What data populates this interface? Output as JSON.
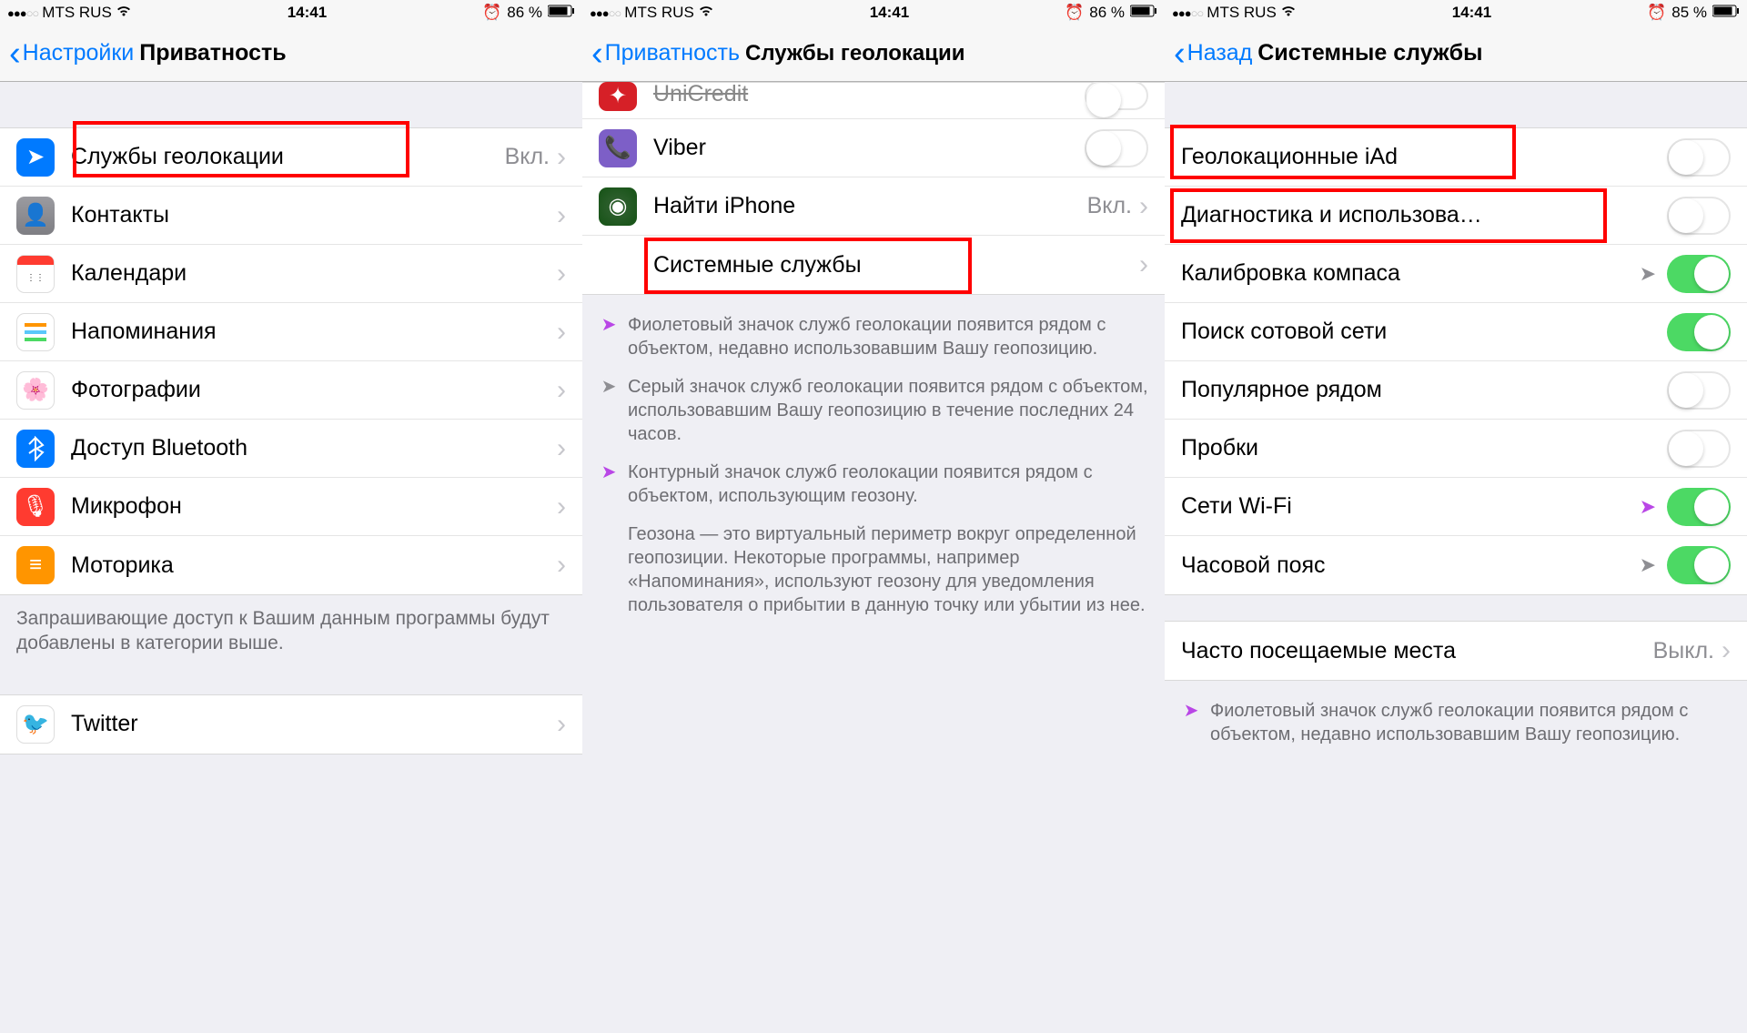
{
  "statusbar": {
    "carrier": "MTS RUS",
    "time": "14:41",
    "battery1": "86 %",
    "battery3": "85 %",
    "dots_left": "●●●",
    "dots_right": "○○"
  },
  "screen1": {
    "back": "Настройки",
    "title": "Приватность",
    "rows": {
      "location": {
        "label": "Службы геолокации",
        "value": "Вкл."
      },
      "contacts": {
        "label": "Контакты"
      },
      "calendars": {
        "label": "Календари"
      },
      "reminders": {
        "label": "Напоминания"
      },
      "photos": {
        "label": "Фотографии"
      },
      "bluetooth": {
        "label": "Доступ Bluetooth"
      },
      "microphone": {
        "label": "Микрофон"
      },
      "motion": {
        "label": "Моторика"
      }
    },
    "footer": "Запрашивающие доступ к Вашим данным программы будут добавлены в категории выше.",
    "twitter": {
      "label": "Twitter"
    }
  },
  "screen2": {
    "back": "Приватность",
    "title": "Службы геолокации",
    "rows": {
      "unicredit": {
        "label": "UniCredit"
      },
      "viber": {
        "label": "Viber"
      },
      "findmy": {
        "label": "Найти iPhone",
        "value": "Вкл."
      },
      "system": {
        "label": "Системные службы"
      }
    },
    "info": {
      "purple": "Фиолетовый значок служб геолокации появится рядом с объектом, недавно использовавшим Вашу геопозицию.",
      "gray": "Серый значок служб геолокации появится рядом с объектом, использовавшим Вашу геопозицию в течение последних 24 часов.",
      "outline": "Контурный значок служб геолокации появится рядом с объектом, использующим геозону.",
      "geofence": "Геозона — это виртуальный периметр вокруг определенной геопозиции. Некоторые программы, например «Напоминания», используют геозону для уведомления пользователя о прибытии в данную точку или убытии из нее."
    }
  },
  "screen3": {
    "back": "Назад",
    "title": "Системные службы",
    "rows": {
      "iad": {
        "label": "Геолокационные iAd"
      },
      "diag": {
        "label": "Диагностика и использова…"
      },
      "compass": {
        "label": "Калибровка компаса"
      },
      "cell": {
        "label": "Поиск сотовой сети"
      },
      "popular": {
        "label": "Популярное рядом"
      },
      "traffic": {
        "label": "Пробки"
      },
      "wifi": {
        "label": "Сети Wi-Fi"
      },
      "timezone": {
        "label": "Часовой пояс"
      },
      "frequent": {
        "label": "Часто посещаемые места",
        "value": "Выкл."
      }
    },
    "info": {
      "purple": "Фиолетовый значок служб геолокации появится рядом с объектом, недавно использовавшим Вашу геопозицию."
    }
  }
}
